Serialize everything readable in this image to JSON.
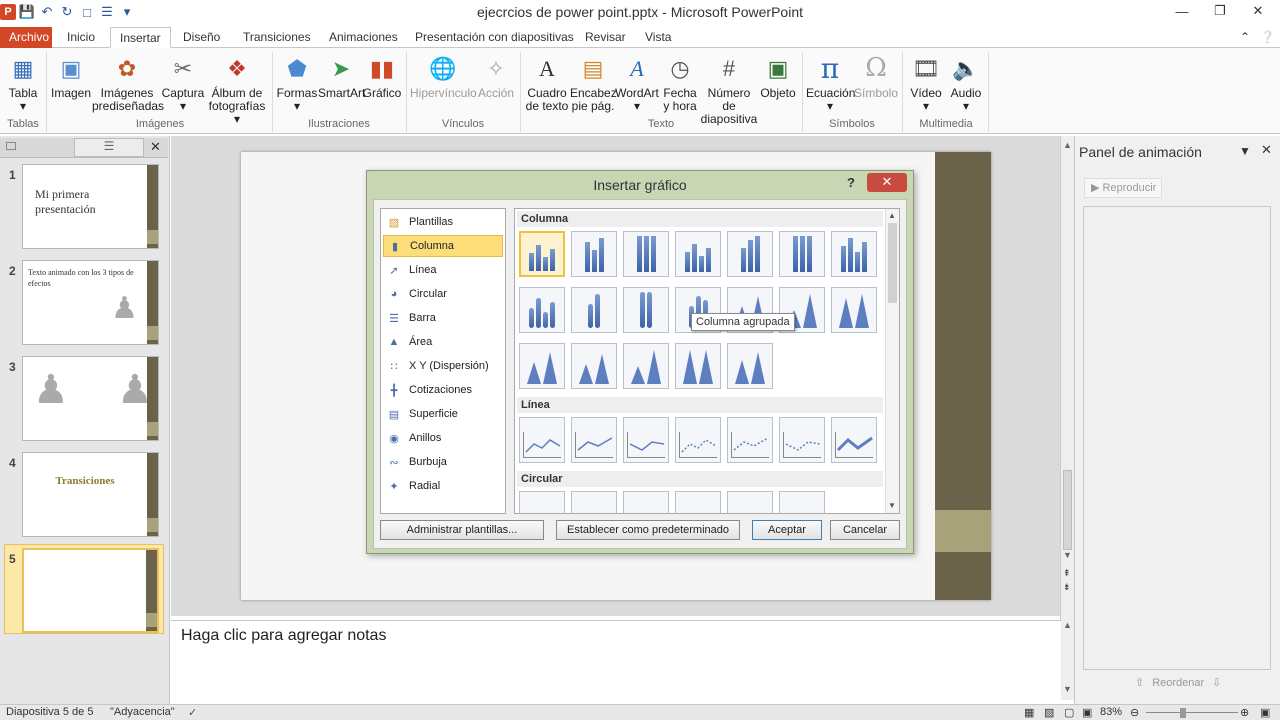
{
  "window": {
    "title": "ejecrcios de power point.pptx - Microsoft PowerPoint",
    "app_badge": "P",
    "minimize": "—",
    "restore": "❐",
    "close": "✕"
  },
  "tabs": [
    {
      "label": "Archivo"
    },
    {
      "label": "Inicio"
    },
    {
      "label": "Insertar"
    },
    {
      "label": "Diseño"
    },
    {
      "label": "Transiciones"
    },
    {
      "label": "Animaciones"
    },
    {
      "label": "Presentación con diapositivas"
    },
    {
      "label": "Revisar"
    },
    {
      "label": "Vista"
    }
  ],
  "ribbon": {
    "buttons": [
      {
        "label": "Tabla",
        "label2": "▾",
        "icon": "table-icon"
      },
      {
        "label": "Imagen",
        "label2": "",
        "icon": "picture-icon"
      },
      {
        "label": "Imágenes",
        "label2": "prediseñadas",
        "icon": "clipart-icon"
      },
      {
        "label": "Captura",
        "label2": "▾",
        "icon": "screenshot-icon"
      },
      {
        "label": "Álbum de",
        "label2": "fotografías ▾",
        "icon": "photo-album-icon"
      },
      {
        "label": "Formas",
        "label2": "▾",
        "icon": "shapes-icon"
      },
      {
        "label": "SmartArt",
        "label2": "",
        "icon": "smartart-icon"
      },
      {
        "label": "Gráfico",
        "label2": "",
        "icon": "chart-icon"
      },
      {
        "label": "Hipervínculo",
        "label2": "",
        "icon": "hyperlink-icon"
      },
      {
        "label": "Acción",
        "label2": "",
        "icon": "action-icon"
      },
      {
        "label": "Cuadro",
        "label2": "de texto",
        "icon": "textbox-icon"
      },
      {
        "label": "Encabez.",
        "label2": "pie pág.",
        "icon": "header-footer-icon"
      },
      {
        "label": "WordArt",
        "label2": "▾",
        "icon": "wordart-icon"
      },
      {
        "label": "Fecha",
        "label2": "y hora",
        "icon": "date-time-icon"
      },
      {
        "label": "Número de",
        "label2": "diapositiva",
        "icon": "slide-number-icon"
      },
      {
        "label": "Objeto",
        "label2": "",
        "icon": "object-icon"
      },
      {
        "label": "Ecuación",
        "label2": "▾",
        "icon": "equation-icon"
      },
      {
        "label": "Símbolo",
        "label2": "",
        "icon": "symbol-icon"
      },
      {
        "label": "Vídeo",
        "label2": "▾",
        "icon": "video-icon"
      },
      {
        "label": "Audio",
        "label2": "▾",
        "icon": "audio-icon"
      }
    ],
    "groups": [
      "Tablas",
      "Imágenes",
      "Ilustraciones",
      "Vínculos",
      "Texto",
      "Símbolos",
      "Multimedia"
    ]
  },
  "slides": [
    {
      "num": "1",
      "text": "Mi primera presentación"
    },
    {
      "num": "2",
      "text": "Texto animado con los 3 tipos de efectos"
    },
    {
      "num": "3",
      "text": ""
    },
    {
      "num": "4",
      "text": "Transiciones"
    },
    {
      "num": "5",
      "text": ""
    }
  ],
  "dialog": {
    "title": "Insertar gráfico",
    "help": "?",
    "close": "✕",
    "categories": [
      {
        "label": "Plantillas",
        "icon": "folder-icon"
      },
      {
        "label": "Columna",
        "icon": "column-chart-icon"
      },
      {
        "label": "Línea",
        "icon": "line-chart-icon"
      },
      {
        "label": "Circular",
        "icon": "pie-chart-icon"
      },
      {
        "label": "Barra",
        "icon": "bar-chart-icon"
      },
      {
        "label": "Área",
        "icon": "area-chart-icon"
      },
      {
        "label": "X Y (Dispersión)",
        "icon": "scatter-chart-icon"
      },
      {
        "label": "Cotizaciones",
        "icon": "stock-chart-icon"
      },
      {
        "label": "Superficie",
        "icon": "surface-chart-icon"
      },
      {
        "label": "Anillos",
        "icon": "doughnut-chart-icon"
      },
      {
        "label": "Burbuja",
        "icon": "bubble-chart-icon"
      },
      {
        "label": "Radial",
        "icon": "radar-chart-icon"
      }
    ],
    "sections": {
      "columna": "Columna",
      "linea": "Línea",
      "circular": "Circular"
    },
    "tooltip": "Columna agrupada",
    "buttons": {
      "manage": "Administrar plantillas...",
      "default": "Establecer como predeterminado",
      "ok": "Aceptar",
      "cancel": "Cancelar"
    }
  },
  "notes": {
    "placeholder": "Haga clic para agregar notas"
  },
  "animation_panel": {
    "title": "Panel de animación",
    "play": "Reproducir",
    "reorder": "Reordenar"
  },
  "status": {
    "slide": "Diapositiva 5 de 5",
    "theme": "\"Adyacencia\"",
    "zoom": "83%"
  }
}
